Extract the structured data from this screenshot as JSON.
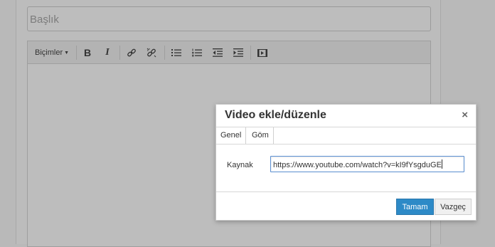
{
  "form": {
    "title_placeholder": "Başlık"
  },
  "toolbar": {
    "format_label": "Biçimler",
    "icons": [
      "caret-down-icon",
      "bold-icon",
      "italic-icon",
      "link-icon",
      "unlink-icon",
      "bullet-list-icon",
      "numbered-list-icon",
      "outdent-icon",
      "indent-icon",
      "video-icon"
    ],
    "bold_glyph": "B",
    "italic_glyph": "I"
  },
  "dialog": {
    "title": "Video ekle/düzenle",
    "close_glyph": "×",
    "tabs": [
      {
        "label": "Genel",
        "active": true
      },
      {
        "label": "Göm",
        "active": false
      }
    ],
    "source_label": "Kaynak",
    "source_value": "https://www.youtube.com/watch?v=kI9fYsgduGE",
    "ok_label": "Tamam",
    "cancel_label": "Vazgeç"
  },
  "colors": {
    "primary_button": "#2d8ac7",
    "backdrop": "#b9b9b9"
  }
}
